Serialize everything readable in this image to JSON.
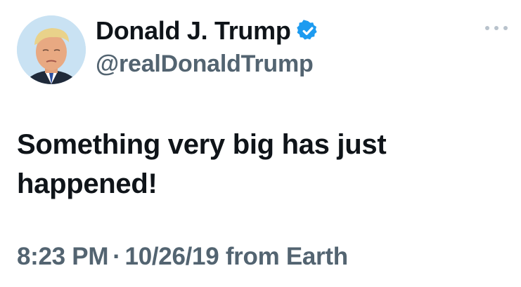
{
  "tweet": {
    "display_name": "Donald J. Trump",
    "handle": "@realDonaldTrump",
    "verified": true,
    "verified_icon": "verified-badge-icon",
    "text": "Something very big has just happened!",
    "time": "8:23 PM",
    "separator": "·",
    "date": "10/26/19",
    "source": "from Earth",
    "more_icon": "more-options-icon"
  },
  "colors": {
    "text_primary": "#0f1419",
    "text_secondary": "#536471",
    "verified_blue": "#1d9bf0",
    "more_dots": "#b8c2cc",
    "background": "#ffffff"
  }
}
